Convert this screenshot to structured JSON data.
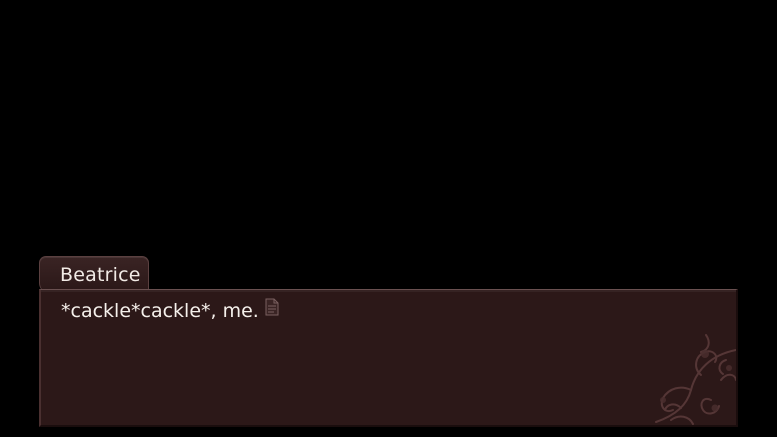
{
  "dialogue": {
    "speaker": "Beatrice",
    "line": "*cackle*cackle*, me."
  },
  "icons": {
    "advance": "page-icon",
    "ornament": "floral-ornament-icon"
  },
  "colors": {
    "background": "#000000",
    "text_box": "#2c1818",
    "name_tab": "#3a2424",
    "text": "#f6f1ec",
    "ornament": "#5a3a3a"
  }
}
